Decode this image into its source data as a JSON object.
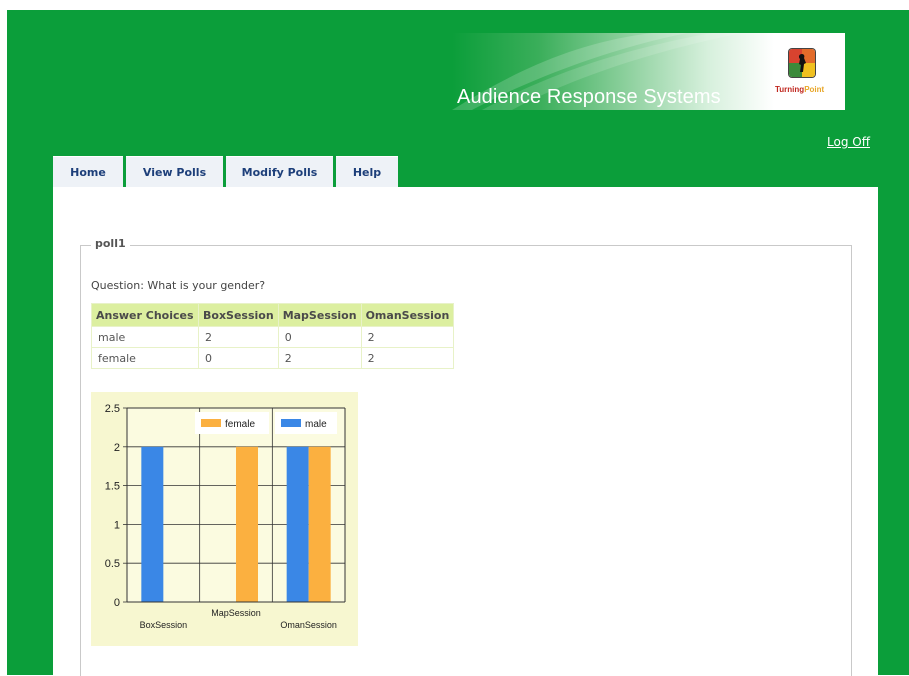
{
  "header": {
    "banner_title": "Audience Response Systems",
    "logo_text_1": "Turning",
    "logo_text_2": "Point",
    "log_off": "Log Off"
  },
  "nav": {
    "items": [
      {
        "label": "Home"
      },
      {
        "label": "View Polls"
      },
      {
        "label": "Modify Polls"
      },
      {
        "label": "Help"
      }
    ]
  },
  "poll": {
    "name": "poll1",
    "question": "Question: What is your gender?",
    "table": {
      "headers": [
        "Answer Choices",
        "BoxSession",
        "MapSession",
        "OmanSession"
      ],
      "rows": [
        [
          "male",
          "2",
          "0",
          "2"
        ],
        [
          "female",
          "0",
          "2",
          "2"
        ]
      ]
    }
  },
  "colors": {
    "page_green": "#0b9e3a",
    "nav_text": "#1d3f7a",
    "table_header_bg": "#dcefa0",
    "chart_bg": "#f7f7d0",
    "female": "#fbb040",
    "male": "#3a87e6"
  },
  "chart_data": {
    "type": "bar",
    "categories": [
      "BoxSession",
      "MapSession",
      "OmanSession"
    ],
    "series": [
      {
        "name": "male",
        "values": [
          2,
          0,
          2
        ],
        "color": "#3a87e6"
      },
      {
        "name": "female",
        "values": [
          0,
          2,
          2
        ],
        "color": "#fbb040"
      }
    ],
    "ylim": [
      0,
      2.5
    ],
    "yticks": [
      "0",
      "0.5",
      "1",
      "1.5",
      "2",
      "2.5"
    ],
    "legend_order": [
      "female",
      "male"
    ],
    "legend_position": "top-right",
    "grid": true
  }
}
